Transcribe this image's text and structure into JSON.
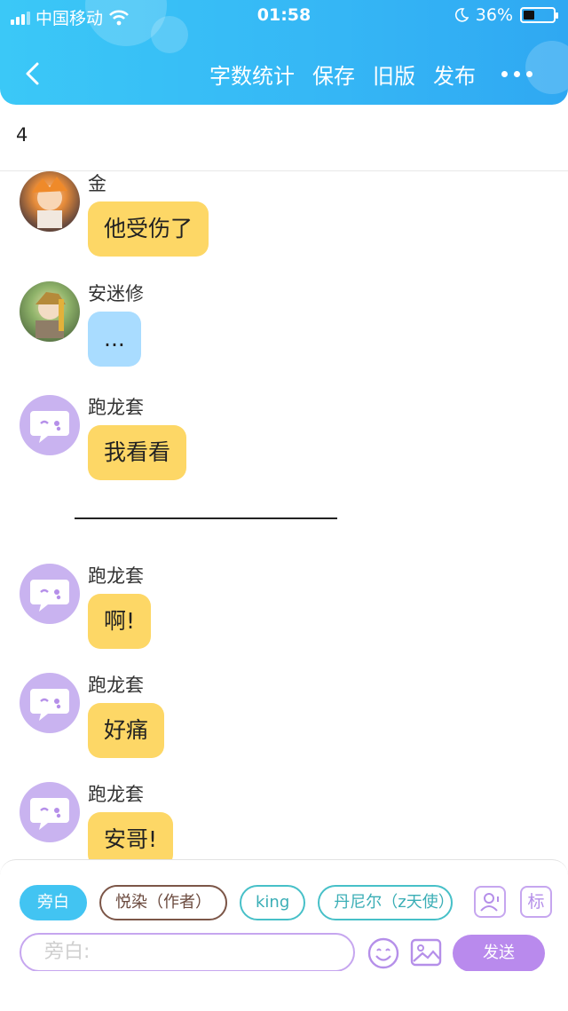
{
  "status_bar": {
    "carrier": "中国移动",
    "time": "01:58",
    "battery": "36%"
  },
  "navbar": {
    "actions": [
      "字数统计",
      "保存",
      "旧版",
      "发布"
    ]
  },
  "chapter_number": "4",
  "messages": [
    {
      "sender": "金",
      "text": "他受伤了"
    },
    {
      "sender": "安迷修",
      "text": "..."
    },
    {
      "sender": "跑龙套",
      "text": "我看看"
    },
    {
      "sender": "跑龙套",
      "text": "啊!"
    },
    {
      "sender": "跑龙套",
      "text": "好痛"
    },
    {
      "sender": "跑龙套",
      "text": "安哥!"
    }
  ],
  "composer": {
    "roles": [
      "旁白",
      "悦染（作者）",
      "king",
      "丹尼尔（z天使）"
    ],
    "tag_label": "标",
    "input_placeholder": "旁白:",
    "send_label": "发送"
  },
  "colors": {
    "header": "#35b6f5",
    "bubble_yellow": "#fdd766",
    "bubble_blue": "#a9dcff",
    "accent_purple": "#b98aed"
  }
}
